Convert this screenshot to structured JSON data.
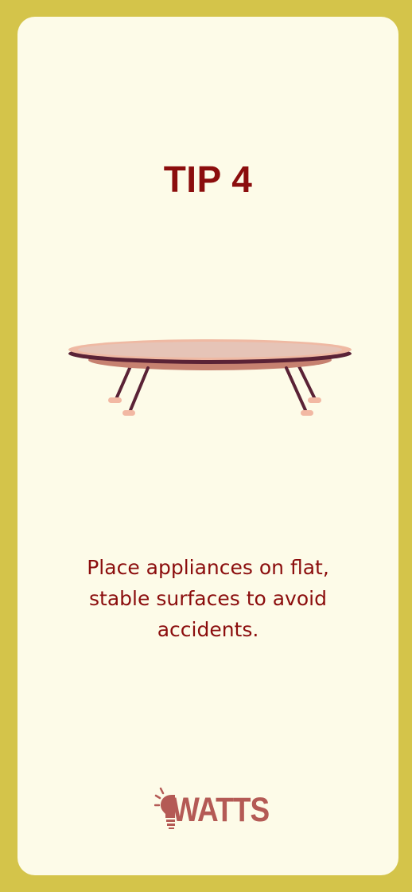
{
  "card": {
    "title": "TIP 4",
    "illustration_icon": "low-round-table-icon",
    "tip_text": "Place appliances on flat, stable surfaces to avoid accidents."
  },
  "brand": {
    "logo_text": "WATTS",
    "logo_icon": "lightbulb-icon"
  },
  "colors": {
    "frame": "#d4c44a",
    "card_background": "#fdfbe8",
    "title_text": "#8b0d0d",
    "logo": "#b45a55",
    "table_top": "#e6c0b2",
    "table_edge": "#5a2236",
    "table_apron": "#c68170",
    "table_feet": "#f2b8a3"
  }
}
